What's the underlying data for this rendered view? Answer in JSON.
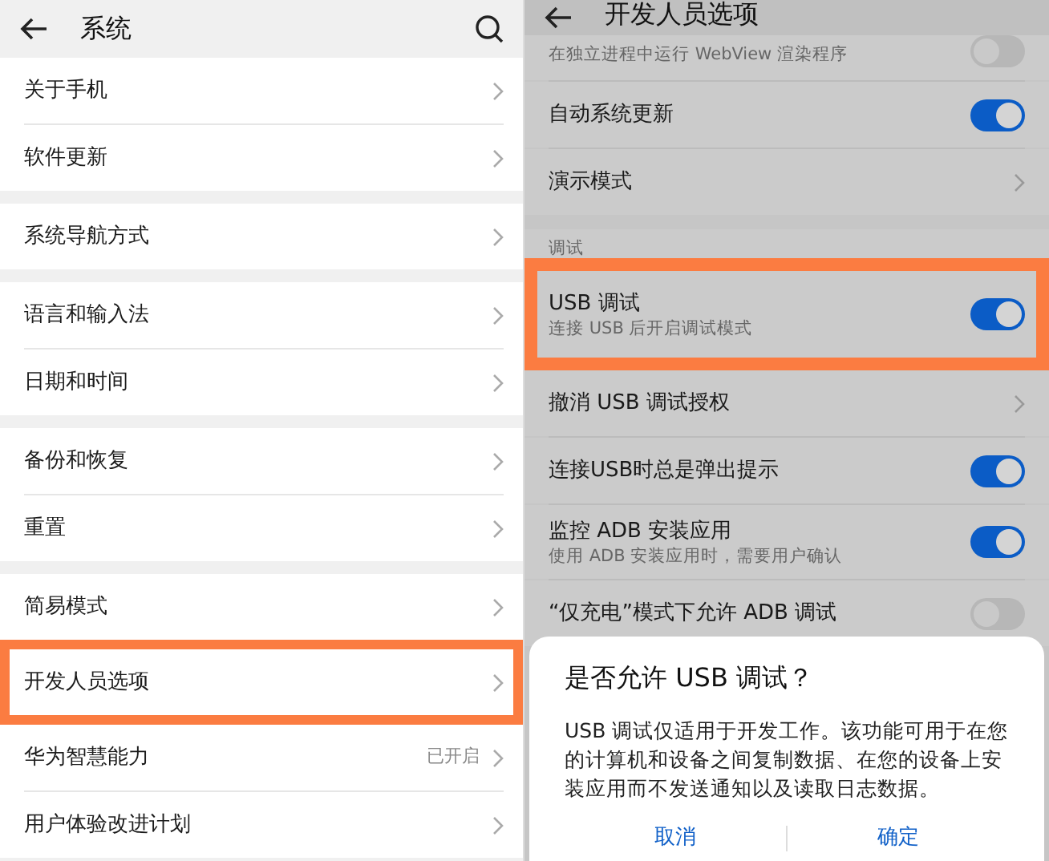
{
  "left": {
    "title": "系统",
    "groups": [
      [
        {
          "label": "关于手机",
          "highlighted": false
        },
        {
          "label": "软件更新",
          "highlighted": false
        }
      ],
      [
        {
          "label": "系统导航方式",
          "highlighted": false
        }
      ],
      [
        {
          "label": "语言和输入法",
          "highlighted": false
        },
        {
          "label": "日期和时间",
          "highlighted": false
        }
      ],
      [
        {
          "label": "备份和恢复",
          "highlighted": false
        },
        {
          "label": "重置",
          "highlighted": false
        }
      ],
      [
        {
          "label": "简易模式",
          "highlighted": false
        },
        {
          "label": "开发人员选项",
          "highlighted": true
        },
        {
          "label": "华为智慧能力",
          "value": "已开启",
          "highlighted": false
        },
        {
          "label": "用户体验改进计划",
          "highlighted": false
        }
      ]
    ]
  },
  "right": {
    "title": "开发人员选项",
    "rows": [
      {
        "kind": "toggle",
        "subtitle": "在独立进程中运行 WebView 渲染程序",
        "on": false,
        "highlighted": false
      },
      {
        "kind": "toggle",
        "label": "自动系统更新",
        "on": true,
        "highlighted": false
      },
      {
        "kind": "link",
        "label": "演示模式",
        "highlighted": false
      },
      {
        "kind": "gap"
      },
      {
        "kind": "section",
        "label": "调试"
      },
      {
        "kind": "toggle",
        "label": "USB 调试",
        "subtitle": "连接 USB 后开启调试模式",
        "on": true,
        "highlighted": true
      },
      {
        "kind": "link",
        "label": "撤消 USB 调试授权",
        "highlighted": false
      },
      {
        "kind": "toggle",
        "label": "连接USB时总是弹出提示",
        "on": true,
        "highlighted": false
      },
      {
        "kind": "toggle",
        "label": "监控 ADB 安装应用",
        "subtitle": "使用 ADB 安装应用时，需要用户确认",
        "on": true,
        "highlighted": false
      },
      {
        "kind": "toggle",
        "label": "“仅充电”模式下允许 ADB 调试",
        "on": false,
        "highlighted": false
      }
    ],
    "dialog": {
      "title": "是否允许 USB 调试？",
      "message": "USB 调试仅适用于开发工作。该功能可用于在您的计算机和设备之间复制数据、在您的设备上安装应用而不发送通知以及读取日志数据。",
      "buttons": [
        "取消",
        "确定"
      ]
    }
  }
}
